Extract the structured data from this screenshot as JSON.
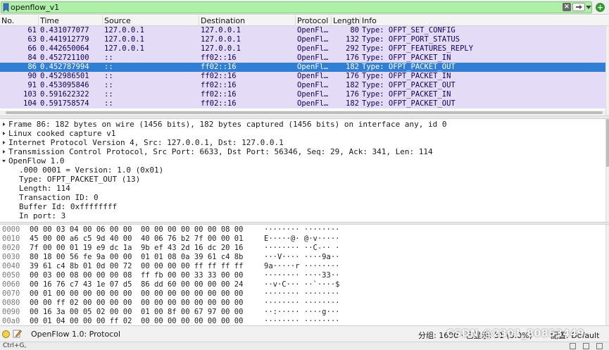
{
  "filter": {
    "value": "openflow_v1",
    "clear_label": "×",
    "add_label": "+"
  },
  "packet_list": {
    "columns": [
      "No.",
      "Time",
      "Source",
      "Destination",
      "Protocol",
      "Length",
      "Info"
    ],
    "rows": [
      {
        "no": "61",
        "time": "0.431077077",
        "src": "127.0.0.1",
        "dst": "127.0.0.1",
        "proto": "OpenFl…",
        "len": "80",
        "info": "Type: OFPT_SET_CONFIG"
      },
      {
        "no": "63",
        "time": "0.441912779",
        "src": "127.0.0.1",
        "dst": "127.0.0.1",
        "proto": "OpenFl…",
        "len": "132",
        "info": "Type: OFPT_PORT_STATUS"
      },
      {
        "no": "66",
        "time": "0.442650064",
        "src": "127.0.0.1",
        "dst": "127.0.0.1",
        "proto": "OpenFl…",
        "len": "292",
        "info": "Type: OFPT_FEATURES_REPLY"
      },
      {
        "no": "84",
        "time": "0.452721100",
        "src": "::",
        "dst": "ff02::16",
        "proto": "OpenFl…",
        "len": "176",
        "info": "Type: OFPT_PACKET_IN"
      },
      {
        "no": "86",
        "time": "0.452787994",
        "src": "::",
        "dst": "ff02::16",
        "proto": "OpenFl…",
        "len": "182",
        "info": "Type: OFPT_PACKET_OUT"
      },
      {
        "no": "90",
        "time": "0.452986501",
        "src": "::",
        "dst": "ff02::16",
        "proto": "OpenFl…",
        "len": "176",
        "info": "Type: OFPT_PACKET_IN"
      },
      {
        "no": "91",
        "time": "0.453095846",
        "src": "::",
        "dst": "ff02::16",
        "proto": "OpenFl…",
        "len": "182",
        "info": "Type: OFPT_PACKET_OUT"
      },
      {
        "no": "103",
        "time": "0.591622322",
        "src": "::",
        "dst": "ff02::16",
        "proto": "OpenFl…",
        "len": "176",
        "info": "Type: OFPT_PACKET_IN"
      },
      {
        "no": "104",
        "time": "0.591758574",
        "src": "::",
        "dst": "ff02::16",
        "proto": "OpenFl…",
        "len": "182",
        "info": "Type: OFPT_PACKET_OUT"
      }
    ],
    "selected_index": 4,
    "colors": {
      "row_bg": "#e4dcf7",
      "row_text": "#12005e",
      "selected_bg": "#2f7fd6"
    }
  },
  "details": {
    "rows": [
      {
        "text": "Frame 86: 182 bytes on wire (1456 bits), 182 bytes captured (1456 bits) on interface any, id 0",
        "expander": "collapsed"
      },
      {
        "text": "Linux cooked capture v1",
        "expander": "collapsed"
      },
      {
        "text": "Internet Protocol Version 4, Src: 127.0.0.1, Dst: 127.0.0.1",
        "expander": "collapsed"
      },
      {
        "text": "Transmission Control Protocol, Src Port: 6633, Dst Port: 56346, Seq: 29, Ack: 341, Len: 114",
        "expander": "collapsed"
      },
      {
        "text": "OpenFlow 1.0",
        "expander": "expanded"
      },
      {
        "text": ".000 0001 = Version: 1.0 (0x01)",
        "expander": "none"
      },
      {
        "text": "Type: OFPT_PACKET_OUT (13)",
        "expander": "none"
      },
      {
        "text": "Length: 114",
        "expander": "none"
      },
      {
        "text": "Transaction ID: 0",
        "expander": "none"
      },
      {
        "text": "Buffer Id: 0xffffffff",
        "expander": "none"
      },
      {
        "text": "In port: 3",
        "expander": "none"
      }
    ]
  },
  "bytes": {
    "rows": [
      {
        "off": "0000",
        "hex": "00 00 03 04 00 06 00 00  00 00 00 00 00 00 08 00",
        "ascii": "········ ········"
      },
      {
        "off": "0010",
        "hex": "45 00 00 a6 c5 9d 40 00  40 06 76 b2 7f 00 00 01",
        "ascii": "E·····@· @·v·····"
      },
      {
        "off": "0020",
        "hex": "7f 00 00 01 19 e9 dc 1a  9b ef 43 2d 16 dc 20 16",
        "ascii": "········ ··C-·· ·"
      },
      {
        "off": "0030",
        "hex": "80 18 00 56 fe 9a 00 00  01 01 08 0a 39 61 c4 8b",
        "ascii": "···V···· ····9a··"
      },
      {
        "off": "0040",
        "hex": "39 61 c4 8b 01 0d 00 72  00 00 00 00 ff ff ff ff",
        "ascii": "9a·····r ········"
      },
      {
        "off": "0050",
        "hex": "00 03 00 08 00 00 00 08  ff fb 00 00 33 33 00 00",
        "ascii": "········ ····33··"
      },
      {
        "off": "0060",
        "hex": "00 16 76 c7 43 1e 07 d5  86 dd 60 00 00 00 00 24",
        "ascii": "··v·C··· ··`····$"
      },
      {
        "off": "0070",
        "hex": "00 01 00 00 00 00 00 00  00 00 00 00 00 00 00 00",
        "ascii": "········ ········"
      },
      {
        "off": "0080",
        "hex": "00 00 ff 02 00 00 00 00  00 00 00 00 00 00 00 00",
        "ascii": "········ ········"
      },
      {
        "off": "0090",
        "hex": "00 16 3a 00 05 02 00 00  01 00 8f 00 67 97 00 00",
        "ascii": "··:····· ····g···"
      },
      {
        "off": "00a0",
        "hex": "00 01 04 00 00 00 ff 02  00 00 00 00 00 00 00 00",
        "ascii": "········ ········"
      }
    ]
  },
  "status": {
    "text": "OpenFlow 1.0: Protocol",
    "packets": "分组: 1690 · 已显示: 51 (3.0%)",
    "profile": "配置: Default",
    "watermark": "CSDN @2301_80853449",
    "shortcut": "Ctrl+G,"
  }
}
